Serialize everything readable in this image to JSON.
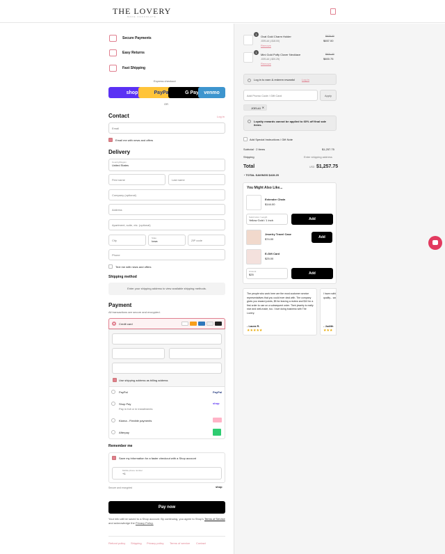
{
  "brand": {
    "name": "THE LOVERY",
    "tag": "MAKE CHOCOLATE"
  },
  "features": [
    "Secure Payments",
    "Easy Returns",
    "Fast Shipping"
  ],
  "express": {
    "title": "Express checkout",
    "or": "OR",
    "buttons": [
      "shop",
      "PayPal",
      "G Pay",
      "venmo"
    ]
  },
  "contact": {
    "title": "Contact",
    "login": "Log in",
    "email_placeholder": "Email",
    "news": "Email me with news and offers"
  },
  "delivery": {
    "title": "Delivery",
    "country_label": "Country/Region",
    "country": "United States",
    "first": "First name",
    "last": "Last name",
    "company": "Company (optional)",
    "address": "Address",
    "apt": "Apartment, suite, etc. (optional)",
    "city": "City",
    "state_label": "State",
    "state": "Iowa",
    "zip": "ZIP code",
    "phone": "Phone",
    "text": "Text me with news and offers"
  },
  "shipping": {
    "title": "Shipping method",
    "note": "Enter your shipping address to view available shipping methods."
  },
  "payment": {
    "title": "Payment",
    "subtitle": "All transactions are secure and encrypted.",
    "credit": "Credit card",
    "billing": "Use shipping address as billing address",
    "paypal": "PayPal",
    "shoppay": "Shop Pay",
    "shoppay_sub": "Pay in full or in installments",
    "klarna": "Klarna - Flexible payments",
    "afterpay": "Afterpay",
    "cards": [
      "VISA",
      "MC",
      "AMEX",
      "DISC",
      "+3"
    ]
  },
  "remember": {
    "title": "Remember me",
    "save": "Save my information for a faster checkout with a Shop account",
    "mobile_label": "Mobile phone number",
    "mobile": "+1",
    "secure": "Secure and encrypted",
    "shop": "shop"
  },
  "pay_now": "Pay now",
  "legal": {
    "text": "Your info will be saved to a Shop account. By continuing, you agree to Shop's",
    "terms": "Terms of Service",
    "and": "and acknowledge the",
    "privacy": "Privacy Policy."
  },
  "footer_links": [
    "Refund policy",
    "Shipping",
    "Privacy policy",
    "Terms of service",
    "Contact"
  ],
  "cart": {
    "items": [
      {
        "qty": "1",
        "name": "Oval Gold Charm Holder",
        "discount": "JOELAI (-$18.00)",
        "remove": "Remove",
        "old": "$675.00",
        "price": "$657.00"
      },
      {
        "qty": "1",
        "name": "Mini Gold Puffy Clover Necklace",
        "discount": "JOELAI (-$20.25)",
        "remove": "Remove",
        "old": "$621.00",
        "price": "$600.75"
      }
    ],
    "rewards": "Log in to earn & redeem rewards!",
    "rewards_link": "Log in",
    "promo_placeholder": "Add Promo Code / Gift Card",
    "apply": "Apply",
    "code": "JOELAI",
    "loyalty": "Loyalty rewards cannot be applied to 60% off final sale items.",
    "instructions": "Add Special Instructions / Gift Note",
    "subtotal_label": "Subtotal · 2 items",
    "subtotal": "$1,257.75",
    "shipping_label": "Shipping",
    "shipping": "Enter shipping address",
    "total_label": "Total",
    "currency": "USD",
    "total": "$1,257.75",
    "savings_label": "TOTAL SAVINGS",
    "savings": "$419.25"
  },
  "upsell": {
    "title": "You Might Also Like...",
    "items": [
      {
        "name": "Extender Chain",
        "price": "$144.00",
        "select_label": "Solid Color / Length",
        "select": "Yellow Gold / 1 inch",
        "btn": "Add"
      },
      {
        "name": "Jewelry Travel Case",
        "price": "$74.00",
        "btn": "Add"
      },
      {
        "name": "E-Gift Card",
        "price": "$25.00",
        "select_label": "Amount",
        "select": "$25",
        "btn": "Add"
      }
    ]
  },
  "reviews": [
    {
      "text": "The people who work here are the most customer service representatives that you could ever deal with. The company gives you reward points, $5 for leaving a review and $10 for a first order to use on a subsequent order. Their jewelry is really nice and well-made, too. I love doing business with The Lovery.",
      "author": "- Laura R.",
      "stars": "★★★★★"
    },
    {
      "text": "I have nothing... Lovery and... The quality... wonderful...",
      "author": "- Judith",
      "stars": "★★★"
    }
  ]
}
